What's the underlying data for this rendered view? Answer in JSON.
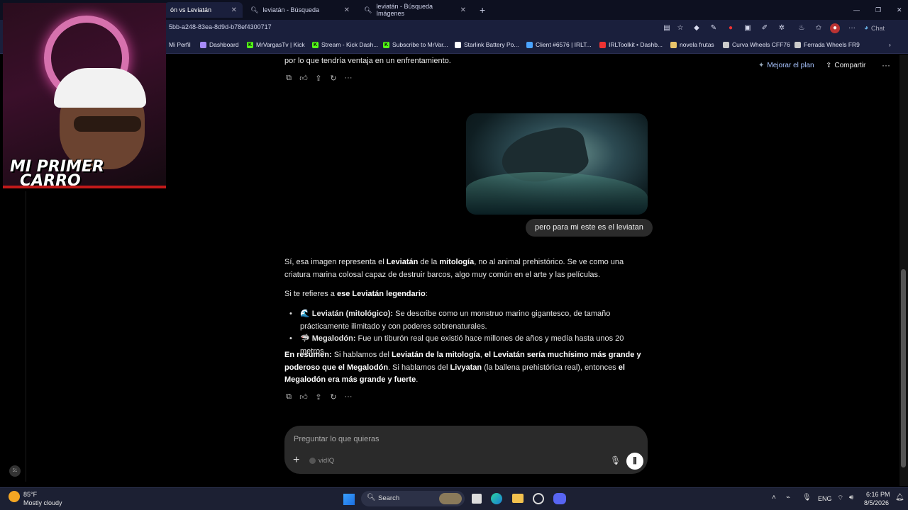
{
  "tabs": [
    {
      "label": "ón vs Leviatán",
      "active": true
    },
    {
      "label": "leviatán - Búsqueda",
      "active": false
    },
    {
      "label": "leviatán - Búsqueda Imágenes",
      "active": false
    }
  ],
  "new_tab": "+",
  "url": "5bb-a248-83ea-8d9d-b78ef4300717",
  "chat_label": "Chat",
  "bookmarks": [
    "Mi Perfil",
    "Dashboard",
    "MrVargasTv | Kick",
    "Stream - Kick Dash...",
    "Subscribe to MrVar...",
    "Starlink Battery Po...",
    "Client #6576 | IRLT...",
    "IRLToolkit • Dashb...",
    "novela frutas",
    "Curva Wheels CFF76",
    "Ferrada Wheels FR9"
  ],
  "webcam": {
    "overlay_text_1": "MI PRIMER",
    "overlay_text_2": "CARRO"
  },
  "header": {
    "upgrade": "Mejorar el plan",
    "share": "Compartir",
    "more": "···"
  },
  "chat": {
    "prev_tail": "por lo que tendría ventaja en un enfrentamiento.",
    "user_message": "pero para mi este es el leviatan",
    "p1_a": "Sí, esa imagen representa el ",
    "p1_b": "Leviatán",
    "p1_c": " de la ",
    "p1_d": "mitología",
    "p1_e": ", no al animal prehistórico. Se ve como una criatura marina colosal capaz de destruir barcos, algo muy común en el arte y las películas.",
    "p2_a": "Si te refieres a ",
    "p2_b": "ese Leviatán legendario",
    "p2_c": ":",
    "li1_emoji": "🌊",
    "li1_b": "Leviatán (mitológico):",
    "li1_t": " Se describe como un monstruo marino gigantesco, de tamaño prácticamente ilimitado y con poderes sobrenaturales.",
    "li2_emoji": "🦈",
    "li2_b": "Megalodón:",
    "li2_t": " Fue un tiburón real que existió hace millones de años y medía hasta unos 20 metros.",
    "p3_a": "En resumen:",
    "p3_b": " Si hablamos del ",
    "p3_c": "Leviatán de la mitología",
    "p3_d": ", ",
    "p3_e": "el Leviatán sería muchísimo más grande y poderoso que el Megalodón",
    "p3_f": ". Si hablamos del ",
    "p3_g": "Livyatan",
    "p3_h": " (la ballena prehistórica real), entonces ",
    "p3_i": "el Megalodón era más grande y fuerte",
    "p3_j": "."
  },
  "composer": {
    "placeholder": "Preguntar lo que quieras",
    "plugin": "vidIQ"
  },
  "taskbar": {
    "temp": "85°F",
    "weather": "Mostly cloudy",
    "search": "Search",
    "lang": "ENG",
    "time": "6:16 PM",
    "date": "8/5/2026"
  },
  "colors": {
    "accent": "#1a1f3c",
    "page_bg": "#000000",
    "bubble": "#2b2b2b"
  }
}
